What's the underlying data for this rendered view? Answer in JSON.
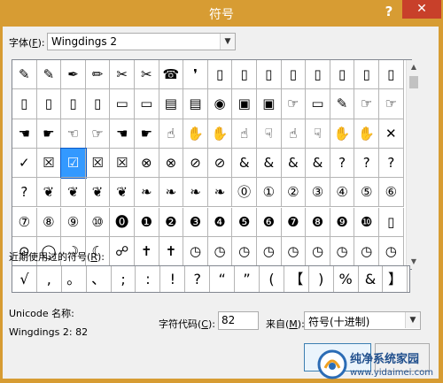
{
  "dialog": {
    "title": "符号",
    "help": "?",
    "close": "✕"
  },
  "font": {
    "label": "字体(",
    "key": "F",
    "label_end": "):",
    "value": "Wingdings 2"
  },
  "grid": {
    "rows": [
      [
        "✎",
        "✎",
        "✒",
        "✏",
        "✂",
        "✂",
        "☎",
        "❜",
        "▯",
        "▯",
        "▯",
        "▯",
        "▯",
        "▯",
        "▯",
        "▯"
      ],
      [
        "▯",
        "▯",
        "▯",
        "▯",
        "▭",
        "▭",
        "▤",
        "▤",
        "◉",
        "▣",
        "▣",
        "☞",
        "▭",
        "✎",
        "☞",
        "☞"
      ],
      [
        "☚",
        "☛",
        "☜",
        "☞",
        "☚",
        "☛",
        "☝",
        "✋",
        "✋",
        "☝",
        "☟",
        "☝",
        "☟",
        "✋",
        "✋",
        "✕"
      ],
      [
        "✓",
        "☒",
        "☑",
        "☒",
        "☒",
        "⊗",
        "⊗",
        "⊘",
        "⊘",
        "&",
        "&",
        "&",
        "&",
        "?",
        "?",
        "?"
      ],
      [
        "?",
        "❦",
        "❦",
        "❦",
        "❦",
        "❧",
        "❧",
        "❧",
        "❧",
        "⓪",
        "①",
        "②",
        "③",
        "④",
        "⑤",
        "⑥"
      ],
      [
        "⑦",
        "⑧",
        "⑨",
        "⑩",
        "⓿",
        "❶",
        "❷",
        "❸",
        "❹",
        "❺",
        "❻",
        "❼",
        "❽",
        "❾",
        "❿",
        "▯"
      ],
      [
        "⊙",
        "◯",
        "☽",
        "☾",
        "☍",
        "✝",
        "✝",
        "◷",
        "◷",
        "◷",
        "◷",
        "◷",
        "◷",
        "◷",
        "◷",
        "◷"
      ]
    ],
    "selected_row": 3,
    "selected_col": 2
  },
  "recent": {
    "label": "近期使用过的符号(",
    "key": "R",
    "label_end": "):",
    "items": [
      "√",
      ",",
      "。",
      "、",
      ";",
      ":",
      "!",
      "?",
      "“",
      "”",
      "(",
      "【",
      ")",
      "%",
      "&",
      "】"
    ]
  },
  "info": {
    "unicode_label": "Unicode 名称:",
    "char_name": "Wingdings 2: 82",
    "code_label": "字符代码(",
    "code_key": "C",
    "code_label_end": "):",
    "code_value": "82",
    "from_label": "来自(",
    "from_key": "M",
    "from_label_end": "):",
    "from_value": "符号(十进制)"
  },
  "watermark": {
    "name": "纯净系统家园",
    "url": "www.yidaimei.com"
  },
  "colors": {
    "title_bar": "#d79c33",
    "close_button": "#c8402a",
    "selection": "#3399ff"
  }
}
